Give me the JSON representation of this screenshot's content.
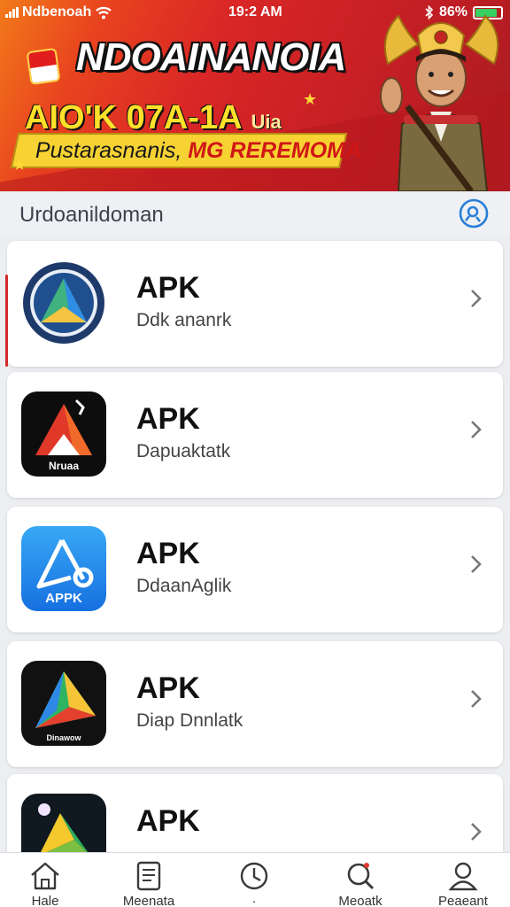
{
  "status_bar": {
    "carrier": "Ndbenoah",
    "time": "19:2 AM",
    "battery": "86%",
    "battery_level": 0.86
  },
  "banner": {
    "title": "NDOAINANOIA",
    "subtitle": "AIO'K 07A-1A",
    "subtitle_suffix": "Uia",
    "tagline": "Pustarasnanis,",
    "tagline_highlight": "MG REREMOMA"
  },
  "section": {
    "title": "Urdoanildoman",
    "action_icon": "search-refresh-icon"
  },
  "apps": [
    {
      "name": "APK",
      "description": "Ddk ananrk",
      "icon": "blue-triangle-seal-icon",
      "icon_label": ""
    },
    {
      "name": "APK",
      "description": "Dapuaktatk",
      "icon": "red-triangle-icon",
      "icon_label": "Nruaa"
    },
    {
      "name": "APK",
      "description": "DdaanAglik",
      "icon": "blue-apk-icon",
      "icon_label": "APPK"
    },
    {
      "name": "APK",
      "description": "Diap Dnnlatk",
      "icon": "rainbow-play-icon",
      "icon_label": "Dinawow"
    },
    {
      "name": "APK",
      "description": "",
      "icon": "green-yellow-triangle-icon",
      "icon_label": ""
    }
  ],
  "bottom_nav": [
    {
      "label": "Hale",
      "icon": "home-icon"
    },
    {
      "label": "Meenata",
      "icon": "document-icon"
    },
    {
      "label": "·",
      "icon": "clock-icon"
    },
    {
      "label": "Meoatk",
      "icon": "search-icon"
    },
    {
      "label": "Peaeant",
      "icon": "profile-icon"
    }
  ]
}
